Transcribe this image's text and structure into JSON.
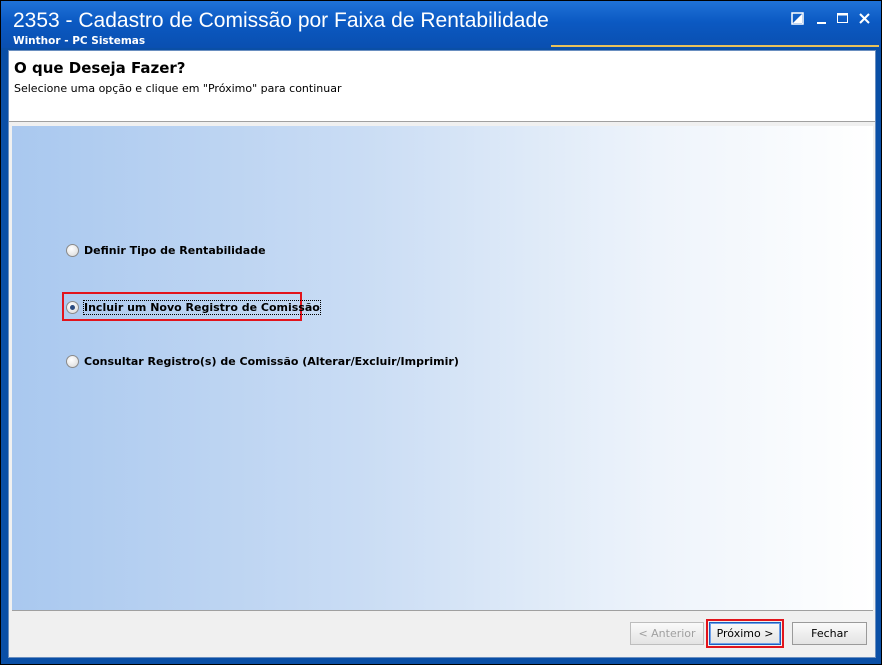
{
  "window": {
    "title": "2353 - Cadastro de Comissão por Faixa de Rentabilidade",
    "subtitle": "Winthor - PC Sistemas"
  },
  "header": {
    "title": "O que Deseja Fazer?",
    "instruction": "Selecione uma opção e clique em \"Próximo\" para continuar"
  },
  "options": [
    {
      "label": "Definir Tipo de Rentabilidade",
      "selected": false
    },
    {
      "label": "Incluir um Novo Registro de Comissão",
      "selected": true
    },
    {
      "label": "Consultar Registro(s) de Comissão (Alterar/Excluir/Imprimir)",
      "selected": false
    }
  ],
  "buttons": {
    "previous": "< Anterior",
    "next": "Próximo >",
    "close": "Fechar"
  },
  "colors": {
    "titlebar": "#0b59c2",
    "highlight": "#e2141c"
  }
}
